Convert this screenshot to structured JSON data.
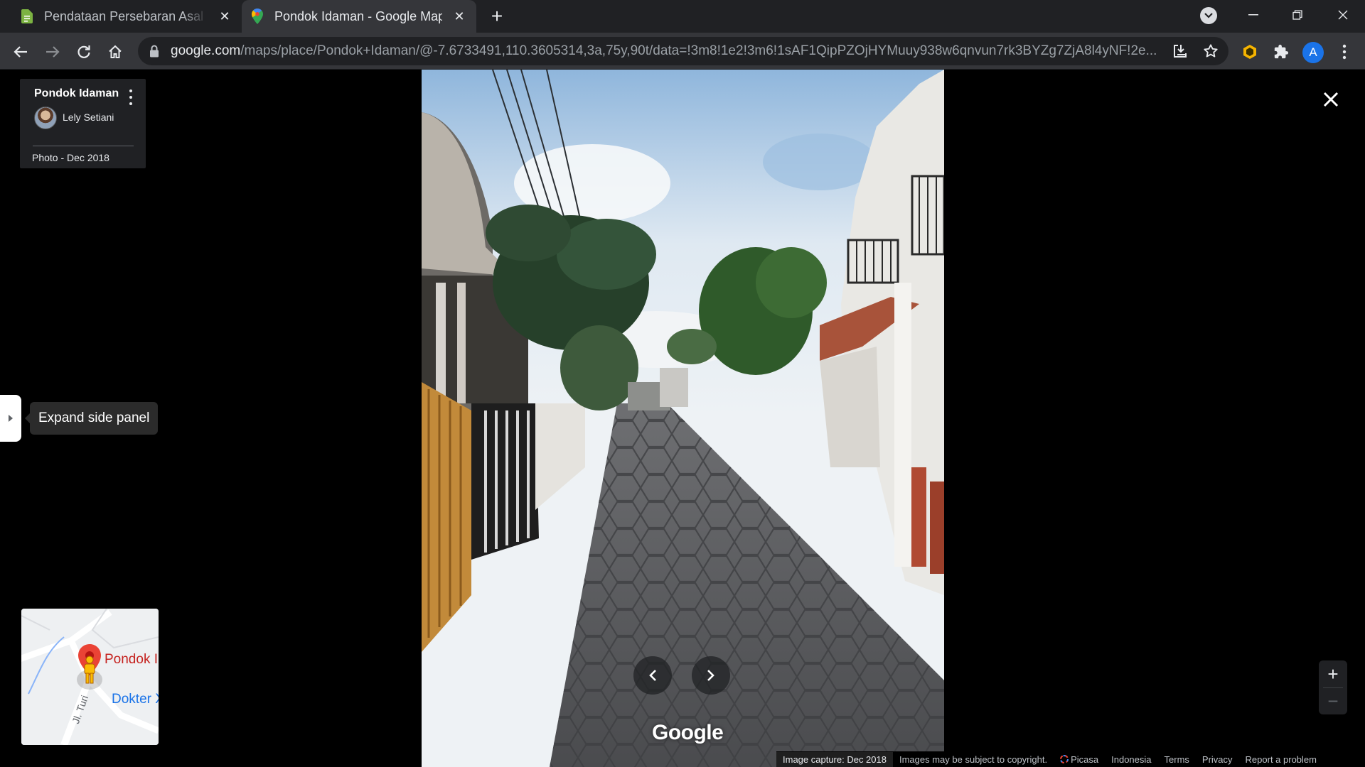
{
  "browser": {
    "tabs": [
      {
        "title": "Pendataan Persebaran Asal Mahasiswa",
        "favicon": "google-forms-icon",
        "active": false
      },
      {
        "title": "Pondok Idaman - Google Maps",
        "favicon": "google-maps-icon",
        "active": true
      }
    ],
    "url_host": "google.com",
    "url_path": "/maps/place/Pondok+Idaman/@-7.6733491,110.3605314,3a,75y,90t/data=!3m8!1e2!3m6!1sAF1QipPZOjHYMuuy938w6qnvun7rk3BYZg7ZjA8l4yNF!2e...",
    "profile_initial": "A"
  },
  "info_card": {
    "place_name": "Pondok Idaman",
    "author": "Lely Setiani",
    "photo_date": "Photo - Dec 2018"
  },
  "side_panel": {
    "tooltip": "Expand side panel"
  },
  "minimap": {
    "pin_label": "Pondok I",
    "poi_label": "Dokter X",
    "road_label": "Jl. Turi"
  },
  "photo": {
    "watermark": "Google"
  },
  "footer": {
    "capture": "Image capture: Dec 2018",
    "copyright": "Images may be subject to copyright.",
    "picasa": "Picasa",
    "region": "Indonesia",
    "terms": "Terms",
    "privacy": "Privacy",
    "report": "Report a problem"
  },
  "colors": {
    "chrome_dark": "#202124",
    "chrome_toolbar": "#35363a",
    "pin_red": "#ea4335",
    "pegman_yellow": "#fbbc04",
    "link_blue": "#1a73e8"
  }
}
